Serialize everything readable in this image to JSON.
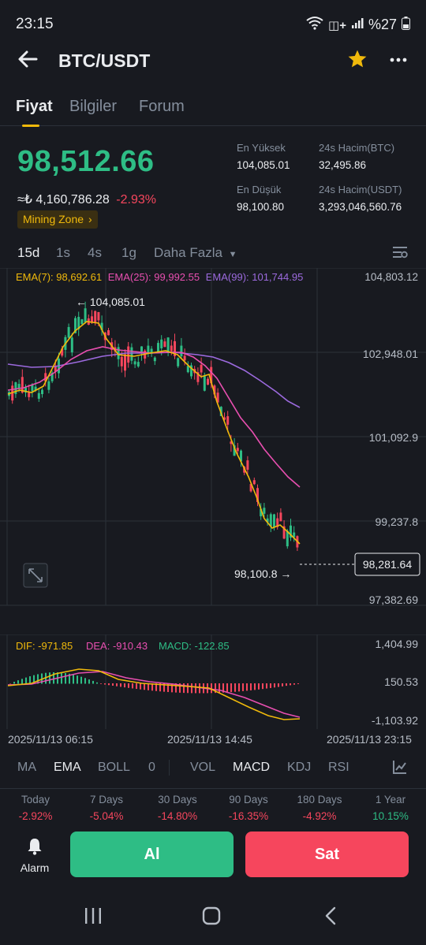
{
  "status": {
    "time": "23:15",
    "battery": "%27"
  },
  "header": {
    "title": "BTC/USDT"
  },
  "tabs": [
    {
      "label": "Fiyat"
    },
    {
      "label": "Bilgiler"
    },
    {
      "label": "Forum"
    }
  ],
  "ticker": {
    "last_price": "98,512.66",
    "fiat_price": "≈₺ 4,160,786.28",
    "change": "-2.93%",
    "mining_zone": "Mining Zone"
  },
  "stats": {
    "high_label": "En Yüksek",
    "high": "104,085.01",
    "low_label": "En Düşük",
    "low": "98,100.80",
    "vol_btc_label": "24s Hacim(BTC)",
    "vol_btc": "32,495.86",
    "vol_usdt_label": "24s Hacim(USDT)",
    "vol_usdt": "3,293,046,560.76"
  },
  "intervals": [
    "15d",
    "1s",
    "4s",
    "1g",
    "Daha Fazla"
  ],
  "ema_legend": {
    "ema7": "EMA(7): 98,692.61",
    "ema25": "EMA(25): 99,992.55",
    "ema99": "EMA(99): 101,744.95"
  },
  "colors": {
    "up": "#2ebd85",
    "down": "#f6465d",
    "ema7": "#f0b90b",
    "ema25": "#e84fb0",
    "ema99": "#9c6ade",
    "brand": "#f0b90b"
  },
  "main_chart": {
    "y_ticks": [
      "104,803.12",
      "102,948.01",
      "101,092.9",
      "99,237.8",
      "97,382.69"
    ],
    "high_marker": "← 104,085.01",
    "low_marker": "98,100.8 →",
    "current_price": "98,281.64"
  },
  "macd": {
    "dif": "DIF: -971.85",
    "dea": "DEA: -910.43",
    "macd": "MACD: -122.85",
    "y_ticks": [
      "1,404.99",
      "150.53",
      "-1,103.92"
    ]
  },
  "time_axis": [
    "2025/11/13 06:15",
    "2025/11/13 14:45",
    "2025/11/13 23:15"
  ],
  "indicator_tabs": [
    "MA",
    "EMA",
    "BOLL",
    "0",
    "VOL",
    "MACD",
    "KDJ",
    "RSI"
  ],
  "performance": [
    {
      "label": "Today",
      "value": "-2.92%"
    },
    {
      "label": "7 Days",
      "value": "-5.04%"
    },
    {
      "label": "30 Days",
      "value": "-14.80%"
    },
    {
      "label": "90 Days",
      "value": "-16.35%"
    },
    {
      "label": "180 Days",
      "value": "-4.92%"
    },
    {
      "label": "1 Year",
      "value": "10.15%"
    }
  ],
  "actions": {
    "alarm": "Alarm",
    "buy": "Al",
    "sell": "Sat"
  }
}
